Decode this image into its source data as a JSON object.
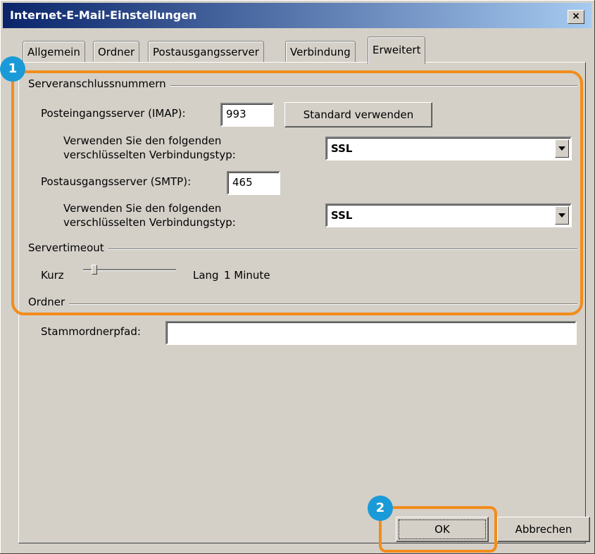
{
  "window": {
    "title": "Internet-E-Mail-Einstellungen",
    "close_symbol": "×"
  },
  "tabs": [
    {
      "label": "Allgemein",
      "active": false
    },
    {
      "label": "Ordner",
      "active": false
    },
    {
      "label": "Postausgangsserver",
      "active": false
    },
    {
      "label": "Verbindung",
      "active": false
    },
    {
      "label": "Erweitert",
      "active": true
    }
  ],
  "server_ports": {
    "group_title": "Serveranschlussnummern",
    "imap_label": "Posteingangsserver (IMAP):",
    "imap_value": "993",
    "default_button": "Standard verwenden",
    "imap_encryption_label_line1": "Verwenden Sie den folgenden",
    "imap_encryption_label_line2": "verschlüsselten Verbindungstyp:",
    "imap_encryption_value": "SSL",
    "smtp_label": "Postausgangsserver (SMTP):",
    "smtp_value": "465",
    "smtp_encryption_label_line1": "Verwenden Sie den folgenden",
    "smtp_encryption_label_line2": "verschlüsselten Verbindungstyp:",
    "smtp_encryption_value": "SSL"
  },
  "server_timeout": {
    "group_title": "Servertimeout",
    "short_label": "Kurz",
    "long_label": "Lang",
    "value_text": "1 Minute",
    "slider_fraction": 0.1
  },
  "folders": {
    "group_title": "Ordner",
    "root_path_label": "Stammordnerpfad:",
    "root_path_value": ""
  },
  "buttons": {
    "ok": "OK",
    "cancel": "Abbrechen"
  },
  "callouts": [
    {
      "number": "1"
    },
    {
      "number": "2"
    }
  ],
  "colors": {
    "highlight": "#f28c1c",
    "badge": "#1a9bd7",
    "dialog_bg": "#d4d0c8"
  }
}
